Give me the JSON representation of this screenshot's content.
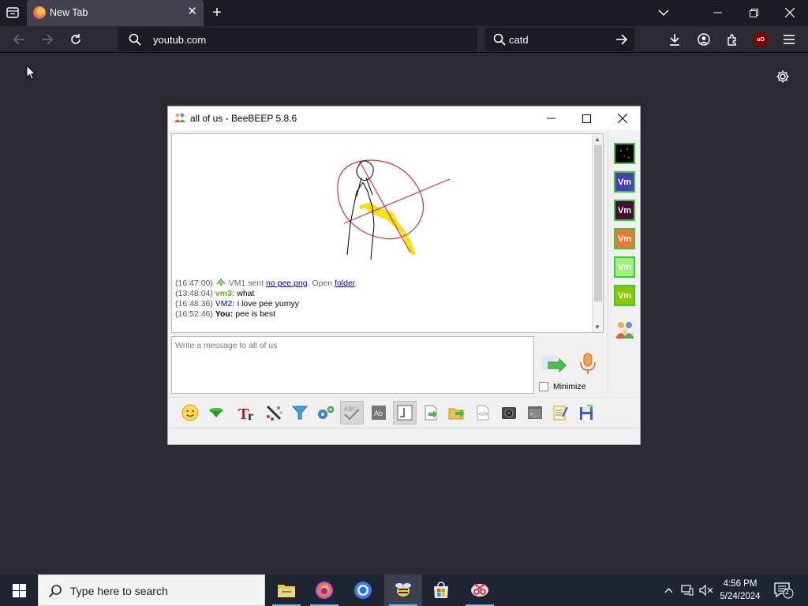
{
  "browser": {
    "tab_title": "New Tab",
    "url": "youtub.com",
    "search_text": "catd"
  },
  "beebeep": {
    "window_title": "all of us - BeeBEEP 5.8.6",
    "messages": [
      {
        "time": "(16:47:00)",
        "sender": "VM1",
        "text_a": "sent",
        "link1": "no pee.png",
        "text_b": ". Open",
        "link2": "folder",
        "text_c": "."
      },
      {
        "time": "(13:48:04)",
        "sender": "vm3:",
        "text": "what"
      },
      {
        "time": "(16:48:36)",
        "sender": "VM2:",
        "text": "i love pee yumyy"
      },
      {
        "time": "(16:52:46)",
        "sender": "You:",
        "text": "pee is best"
      }
    ],
    "input_placeholder": "Write a message to all of us",
    "minimize_label": "Minimize",
    "users": [
      {
        "label": "",
        "color": "#000000"
      },
      {
        "label": "Vm",
        "color": "#4b3fb8"
      },
      {
        "label": "Vm",
        "color": "#4a0a3a"
      },
      {
        "label": "Vm",
        "color": "#ee7733"
      },
      {
        "label": "Vm",
        "color": "#9ef07a"
      },
      {
        "label": "Vm",
        "color": "#8cc800"
      }
    ]
  },
  "taskbar": {
    "search_placeholder": "Type here to search",
    "time": "4:56 PM",
    "date": "5/24/2024",
    "notification_count": "2"
  },
  "colors": {
    "firefox_bg": "#2b2a33",
    "tabbar_bg": "#1c1b22",
    "taskbar_bg": "#1f2433",
    "sketch_red": "#e03030",
    "sketch_yellow": "#f5e11a"
  }
}
